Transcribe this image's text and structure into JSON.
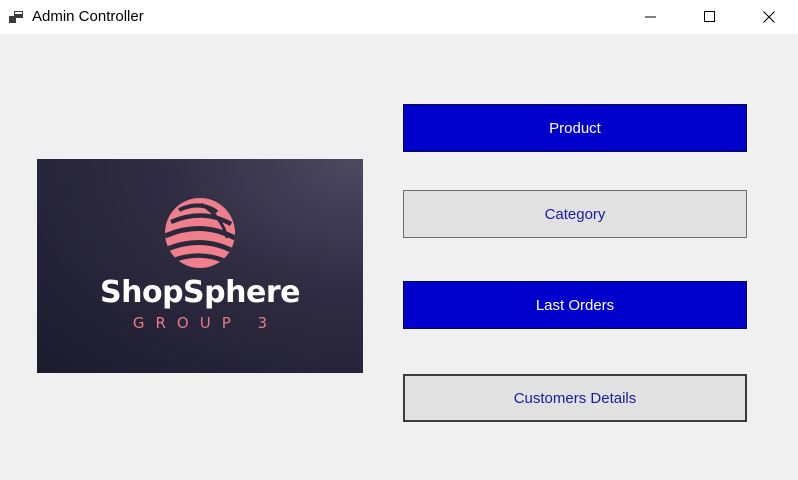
{
  "window": {
    "title": "Admin Controller",
    "icon": "app-window-icon",
    "controls": [
      "minimize-icon",
      "maximize-icon",
      "close-icon"
    ]
  },
  "logo": {
    "brand": "ShopSphere",
    "subtitle": "GROUP 3",
    "colors": {
      "background": "#2a283c",
      "accent": "#f07f8c",
      "text": "#ffffff"
    }
  },
  "buttons": {
    "product": "Product",
    "category": "Category",
    "last_orders": "Last Orders",
    "customers_details": "Customers Details"
  },
  "colors": {
    "primary_button": "#0000cd",
    "secondary_button": "#e1e1e1",
    "secondary_text": "#1a1aa8"
  }
}
